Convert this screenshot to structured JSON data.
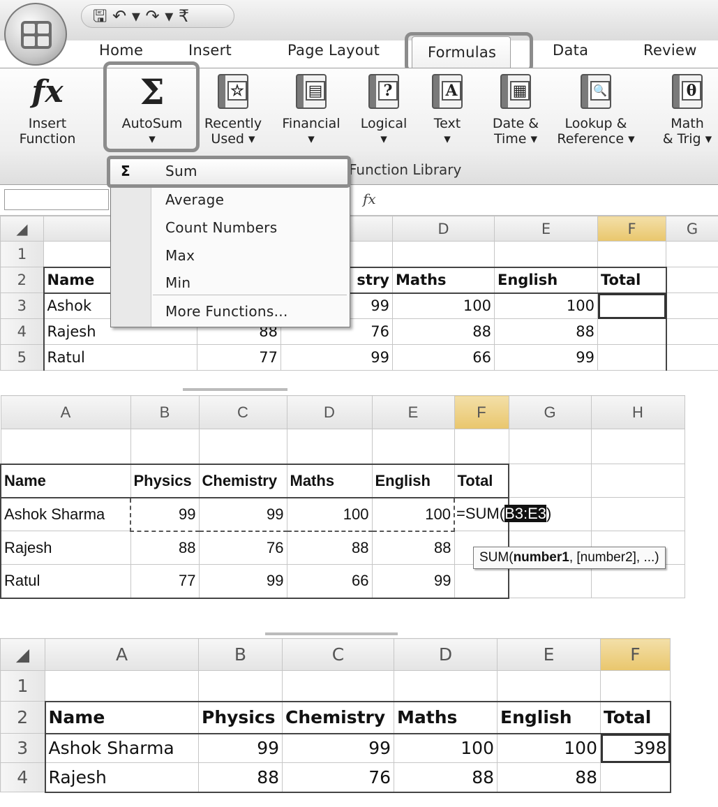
{
  "panel1": {
    "qat": "🖫 ↶ ▾ ↷ ▾  ₹",
    "tabs": [
      "Home",
      "Insert",
      "Page Layout",
      "Formulas",
      "Data",
      "Review"
    ],
    "active_tab": "Formulas",
    "ribbon_buttons": [
      {
        "label": "Insert\nFunction",
        "icon": "fx-icon",
        "glyph": "fx"
      },
      {
        "label": "AutoSum\n▾",
        "icon": "sigma-icon",
        "glyph": "Σ"
      },
      {
        "label": "Recently\nUsed ▾",
        "icon": "star-book-icon",
        "glyph": "☆"
      },
      {
        "label": "Financial\n▾",
        "icon": "financial-book-icon",
        "glyph": "▤"
      },
      {
        "label": "Logical\n▾",
        "icon": "logical-book-icon",
        "glyph": "?"
      },
      {
        "label": "Text\n▾",
        "icon": "text-book-icon",
        "glyph": "A"
      },
      {
        "label": "Date &\nTime ▾",
        "icon": "date-book-icon",
        "glyph": "▦"
      },
      {
        "label": "Lookup &\nReference ▾",
        "icon": "lookup-book-icon",
        "glyph": "🔍"
      },
      {
        "label": "Math\n& Trig ▾",
        "icon": "math-book-icon",
        "glyph": "θ"
      }
    ],
    "group_label": "Function Library",
    "fx_label": "fx",
    "dropdown": {
      "sum_icon": "Σ",
      "items": [
        "Sum",
        "Average",
        "Count Numbers",
        "Max",
        "Min",
        "More Functions..."
      ]
    },
    "col_headers": [
      "",
      "",
      "",
      "",
      "D",
      "E",
      "F",
      "G"
    ],
    "row_numbers": [
      "1",
      "2",
      "3",
      "4",
      "5"
    ],
    "rows": [
      [
        "",
        "",
        "",
        "",
        "",
        ""
      ],
      [
        "Name",
        "",
        "stry",
        "Maths",
        "English",
        "Total"
      ],
      [
        "Ashok",
        "",
        "99",
        "100",
        "100",
        ""
      ],
      [
        "Rajesh",
        "88",
        "76",
        "88",
        "88",
        ""
      ],
      [
        "Ratul",
        "77",
        "99",
        "66",
        "99",
        ""
      ]
    ]
  },
  "panel2": {
    "col_headers": [
      "A",
      "B",
      "C",
      "D",
      "E",
      "F",
      "G",
      "H"
    ],
    "header_row": [
      "Name",
      "Physics",
      "Chemistry",
      "Maths",
      "English",
      "Total"
    ],
    "rows": [
      [
        "Ashok Sharma",
        "99",
        "99",
        "100",
        "100"
      ],
      [
        "Rajesh",
        "88",
        "76",
        "88",
        "88"
      ],
      [
        "Ratul",
        "77",
        "99",
        "66",
        "99"
      ]
    ],
    "formula_prefix": "=SUM(",
    "formula_range": "B3:E3",
    "formula_suffix": ")",
    "tooltip_prefix": "SUM(",
    "tooltip_bold": "number1",
    "tooltip_rest": ", [number2], ...)"
  },
  "panel3": {
    "col_headers": [
      "A",
      "B",
      "C",
      "D",
      "E",
      "F"
    ],
    "row_numbers": [
      "1",
      "2",
      "3",
      "4"
    ],
    "header_row": [
      "Name",
      "Physics",
      "Chemistry",
      "Maths",
      "English",
      "Total"
    ],
    "rows": [
      [
        "Ashok Sharma",
        "99",
        "99",
        "100",
        "100",
        "398"
      ],
      [
        "Rajesh",
        "88",
        "76",
        "88",
        "88",
        ""
      ]
    ]
  }
}
